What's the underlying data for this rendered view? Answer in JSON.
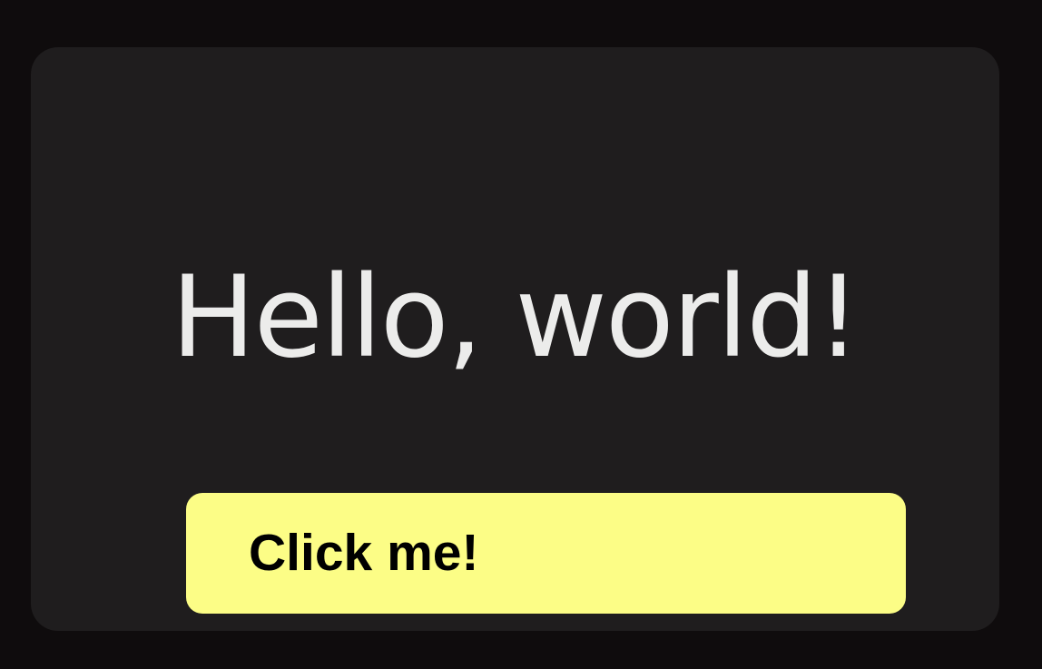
{
  "colors": {
    "page_background": "#0f0c0d",
    "card_background": "#1f1d1e",
    "headline_text": "#ececeb",
    "button_background": "#fcfd86",
    "button_text": "#000000"
  },
  "card": {
    "headline": "Hello, world!",
    "button_label": "Click me!"
  }
}
